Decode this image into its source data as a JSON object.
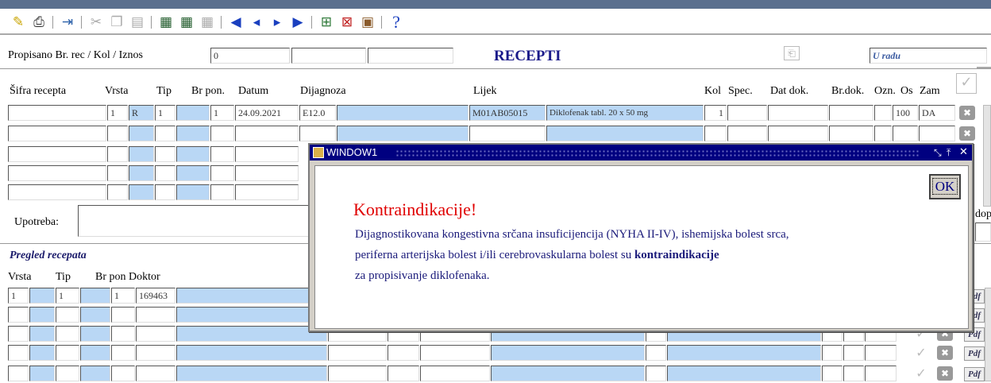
{
  "toolbar": {
    "icons": [
      "open-folder-icon",
      "printer-icon",
      "exit-icon",
      "cut-icon",
      "copy-icon",
      "paste-icon",
      "query-enter-icon",
      "query-execute-icon",
      "query-cancel-icon",
      "first-record-icon",
      "previous-record-icon",
      "next-record-icon",
      "last-record-icon",
      "insert-record-icon",
      "delete-record-icon",
      "save-icon",
      "help-icon"
    ]
  },
  "header": {
    "label": "Propisano  Br. rec / Kol / Iznos",
    "count_value": "0",
    "title": "RECEPTI",
    "status": "U radu"
  },
  "columns": {
    "sifra": "Šifra recepta",
    "vrsta": "Vrsta",
    "tip": "Tip",
    "brpon": "Br pon.",
    "datum": "Datum",
    "dijagnoza": "Dijagnoza",
    "lijek": "Lijek",
    "kol": "Kol",
    "spec": "Spec.",
    "datdok": "Dat dok.",
    "brdok": "Br.dok.",
    "ozn": "Ozn.",
    "os": "Os",
    "zam": "Zam"
  },
  "row1": {
    "vrsta": "1",
    "tip_code": "R",
    "tip": "1",
    "brpon": "1",
    "datum": "24.09.2021",
    "dijagnoza": "E12.0",
    "lijek_code": "M01AB05015",
    "lijek_name": "Diklofenak tabl. 20 x 50 mg",
    "kol": "1",
    "os": "100",
    "zam": "DA"
  },
  "upotreba_label": "Upotreba:",
  "dop_label": "dop",
  "pregled": {
    "title": "Pregled recepata",
    "col_vrsta": "Vrsta",
    "col_tip": "Tip",
    "col_brpon_doktor": "Br pon Doktor",
    "row1_vrsta": "1",
    "row1_tip": "1",
    "row1_brpon": "1",
    "row1_doktor": "169463",
    "pdf_label": "Pdf"
  },
  "dialog": {
    "title": "WINDOW1",
    "ok_label": "OK",
    "heading": "Kontraindikacije!",
    "line1": "Dijagnostikovana kongestivna srčana insuficijencija (NYHA II-IV), ishemijska bolest srca,",
    "line2_a": "periferna arterijska bolest i/ili cerebrovaskularna bolest su ",
    "line2_b": "kontraindikacije",
    "line3": "za propisivanje diklofenaka."
  },
  "colors": {
    "field_blue": "#b9d7f5",
    "title_navy": "#000080",
    "alert_red": "#e00000"
  }
}
